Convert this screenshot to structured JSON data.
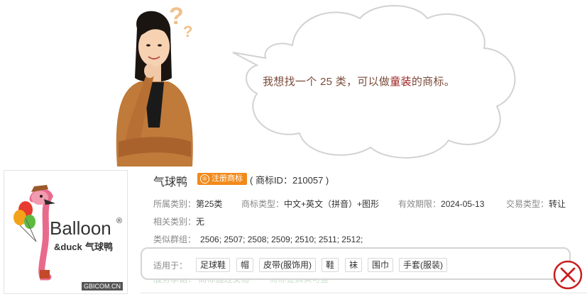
{
  "speech": {
    "before": "我想找一个 25 类，可以做",
    "highlight": "童装",
    "after": "的商标。"
  },
  "trademark": {
    "name": "气球鸭",
    "badge": "注册商标",
    "badge_icon": "®",
    "id_text": "( 商标ID：210057 )",
    "logo": {
      "word_main": "Balloon",
      "word_sub": "&duck",
      "word_cn": "气球鸭",
      "registered": "®",
      "watermark": "GBICOM.CN"
    }
  },
  "details": {
    "category_label": "所属类别：",
    "category_value": "第25类",
    "type_label": "商标类型：",
    "type_value": "中文+英文（拼音）+图形",
    "validity_label": "有效期限：",
    "validity_value": "2024-05-13",
    "trade_label": "交易类型：",
    "trade_value": "转让",
    "related_label": "相关类别：",
    "related_value": "无",
    "group_label": "类似群组：",
    "group_value": "2506; 2507; 2508; 2509; 2510; 2511; 2512;"
  },
  "applicable": {
    "label": "适用于：",
    "items": [
      "足球鞋",
      "帽",
      "皮带(服饰用)",
      "鞋",
      "袜",
      "围巾",
      "手套(服装)"
    ]
  },
  "ghost_row": {
    "label": "服务承诺：",
    "item1": "商标通过交易",
    "item2": "商标证真实可查"
  },
  "colors": {
    "accent_orange": "#f28a1a",
    "close_red": "#c81e1e",
    "speech_text": "#7a4b3a",
    "highlight": "#9b1c1c"
  },
  "icons": {
    "close": "close-circle-icon",
    "question": "question-mark-icon"
  }
}
